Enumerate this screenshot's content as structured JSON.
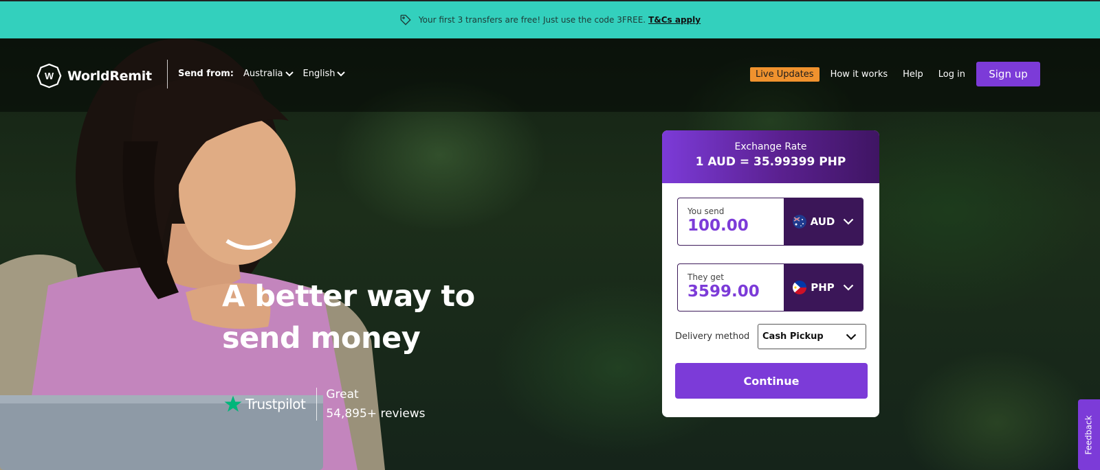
{
  "promo": {
    "text": "Your first 3 transfers are free! Just use the code 3FREE.",
    "link": "T&Cs apply"
  },
  "nav": {
    "brand": "WorldRemit",
    "send_from_label": "Send from:",
    "country": "Australia",
    "language": "English",
    "live_updates": "Live Updates",
    "how_it_works": "How it works",
    "help": "Help",
    "login": "Log in",
    "signup": "Sign up"
  },
  "hero": {
    "headline": "A better way to send money",
    "trustpilot": "Trustpilot",
    "rating": "Great",
    "reviews": "54,895+ reviews"
  },
  "calculator": {
    "rate_label": "Exchange Rate",
    "rate_value": "1 AUD = 35.99399 PHP",
    "send_label": "You send",
    "send_amount": "100.00",
    "send_currency": "AUD",
    "get_label": "They get",
    "get_amount": "3599.00",
    "get_currency": "PHP",
    "delivery_label": "Delivery method",
    "delivery_value": "Cash Pickup",
    "continue": "Continue"
  },
  "feedback": "Feedback",
  "colors": {
    "promo_bg": "#33d0bd",
    "accent": "#7c3bd8",
    "currency_bg": "#3b1658",
    "live_badge": "#f0922e"
  }
}
